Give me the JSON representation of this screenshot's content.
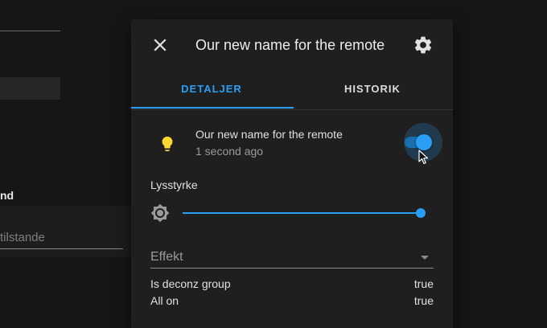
{
  "background": {
    "section_heading": "nd",
    "field_placeholder": "tilstande"
  },
  "dialog": {
    "title": "Our new name for the remote",
    "close_icon": "close-icon",
    "settings_icon": "gear-icon",
    "tabs": [
      {
        "label": "DETALJER",
        "active": true
      },
      {
        "label": "HISTORIK",
        "active": false
      }
    ],
    "entity": {
      "icon": "lightbulb-icon",
      "icon_color": "#fdd835",
      "name": "Our new name for the remote",
      "last_changed": "1 second ago",
      "state_on": true
    },
    "brightness": {
      "label": "Lysstyrke",
      "icon": "brightness-icon",
      "value_fraction": 1.0
    },
    "effect": {
      "label": "Effekt",
      "icon": "caret-down-icon"
    },
    "attributes": [
      {
        "key": "Is deconz group",
        "value": "true"
      },
      {
        "key": "All on",
        "value": "true"
      }
    ],
    "accent_color": "#2a9df4"
  }
}
